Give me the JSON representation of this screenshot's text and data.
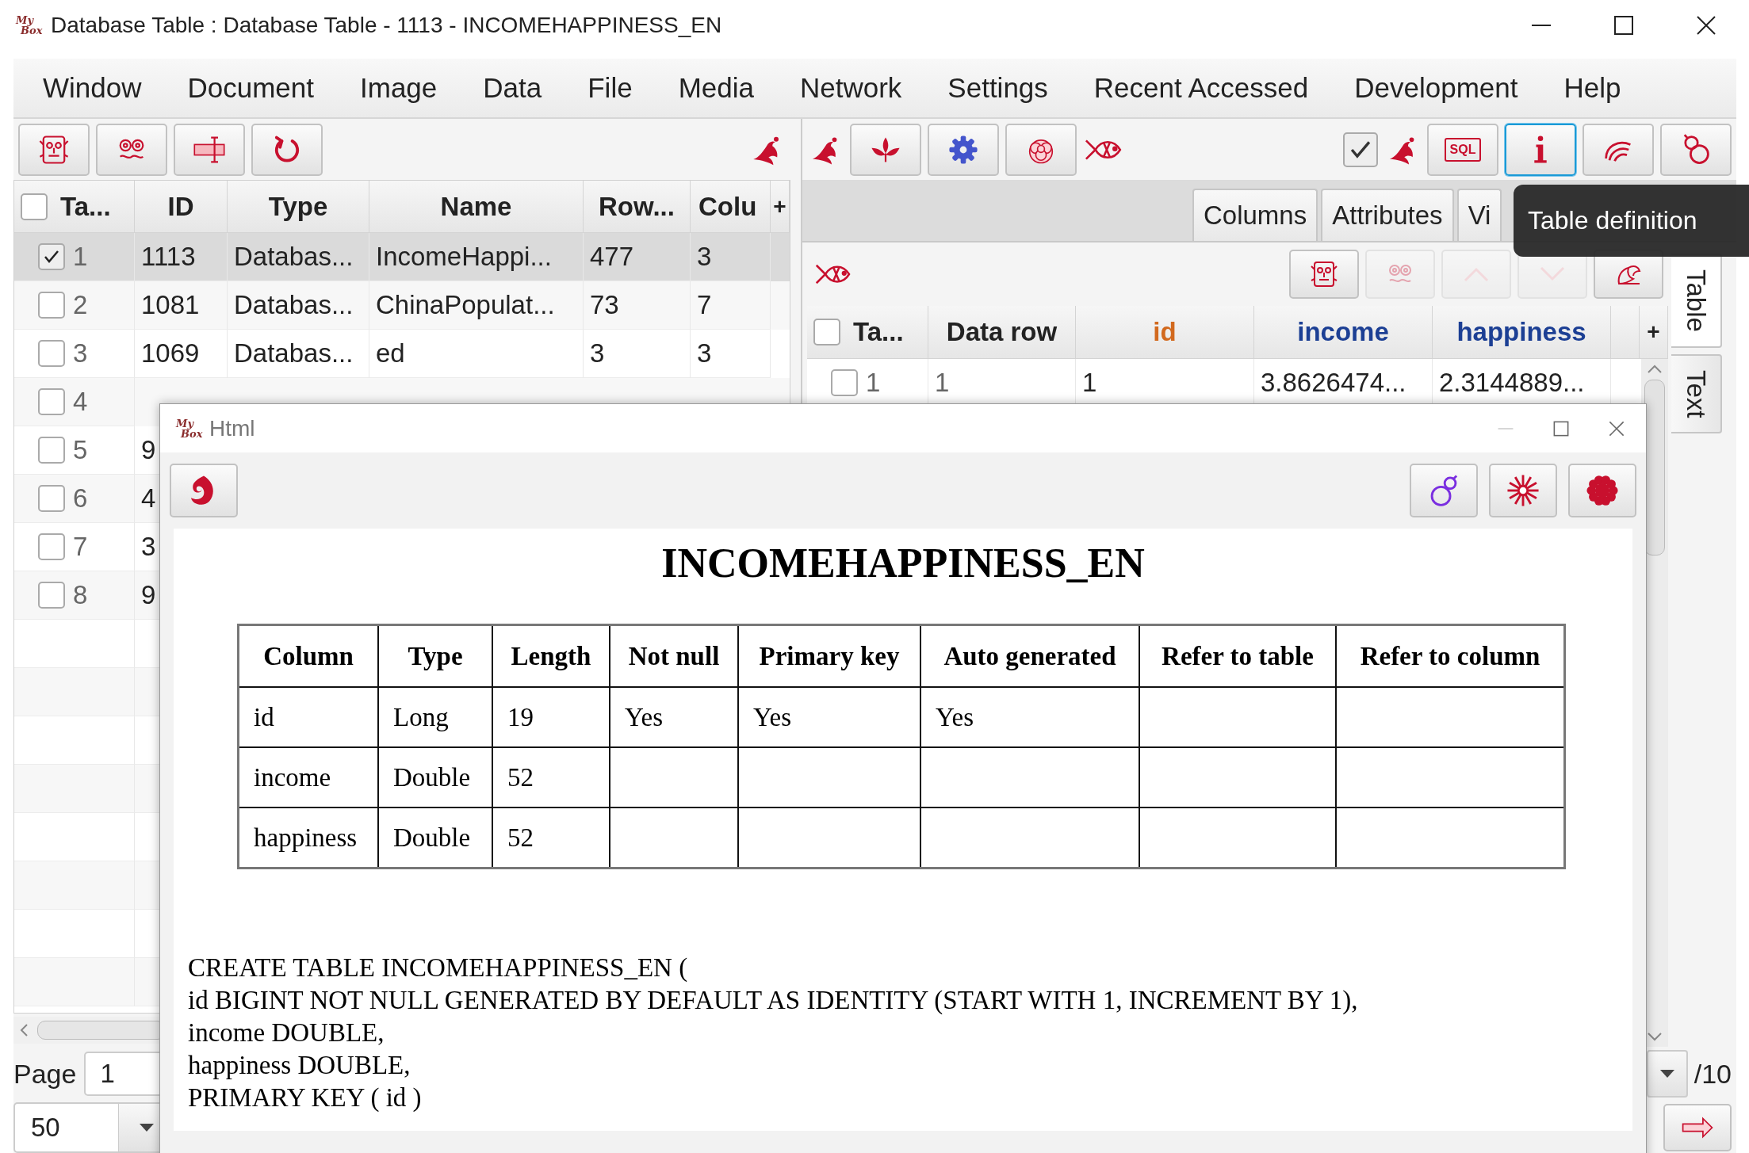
{
  "window": {
    "logo": [
      "My",
      "Box"
    ],
    "title": "Database Table : Database Table - 1113 - INCOMEHAPPINESS_EN"
  },
  "menu": [
    "Window",
    "Document",
    "Image",
    "Data",
    "File",
    "Media",
    "Network",
    "Settings",
    "Recent Accessed",
    "Development",
    "Help"
  ],
  "left_table": {
    "all_checked": false,
    "columns": [
      "Ta...",
      "ID",
      "Type",
      "Name",
      "Row...",
      "Colu"
    ],
    "add_column": "+",
    "rows": [
      {
        "checked": true,
        "selected": true,
        "cells": [
          "1",
          "1113",
          "Databas...",
          "IncomeHappi...",
          "477",
          "3"
        ]
      },
      {
        "checked": false,
        "selected": false,
        "cells": [
          "2",
          "1081",
          "Databas...",
          "ChinaPopulat...",
          "73",
          "7"
        ]
      },
      {
        "checked": false,
        "selected": false,
        "cells": [
          "3",
          "1069",
          "Databas...",
          "ed",
          "3",
          "3"
        ]
      },
      {
        "checked": false,
        "selected": false,
        "cells": [
          "4"
        ]
      },
      {
        "checked": false,
        "selected": false,
        "cells": [
          "5",
          "9"
        ]
      },
      {
        "checked": false,
        "selected": false,
        "cells": [
          "6",
          "4"
        ]
      },
      {
        "checked": false,
        "selected": false,
        "cells": [
          "7",
          "3"
        ]
      },
      {
        "checked": false,
        "selected": false,
        "cells": [
          "8",
          "9"
        ]
      }
    ]
  },
  "pager": {
    "label": "Page",
    "page": "1",
    "page_size": "50",
    "page_total": "/10"
  },
  "right_toolbar": {
    "checkbox": {
      "checked": true
    },
    "sql_label": "SQL",
    "info_focused": true
  },
  "tabs": [
    {
      "label": "Columns",
      "selected": false
    },
    {
      "label": "Attributes",
      "selected": false
    },
    {
      "label": "Vi",
      "selected": false
    }
  ],
  "subtoolbar": [
    {
      "disabled": false
    },
    {
      "disabled": true
    },
    {
      "disabled": true
    },
    {
      "disabled": true
    },
    {
      "disabled": false
    }
  ],
  "data_table": {
    "all_checked": false,
    "columns": [
      {
        "label": "Ta...",
        "kind": "meta"
      },
      {
        "label": "Data row",
        "kind": "meta"
      },
      {
        "label": "id",
        "kind": "key"
      },
      {
        "label": "income",
        "kind": "field"
      },
      {
        "label": "happiness",
        "kind": "field"
      }
    ],
    "add_column": "+",
    "rows": [
      {
        "checked": false,
        "cells": [
          "1",
          "1",
          "1",
          "3.8626474...",
          "2.3144889..."
        ]
      }
    ]
  },
  "side_tabs": [
    {
      "label": "Table",
      "selected": true
    },
    {
      "label": "Text",
      "selected": false
    }
  ],
  "tooltip": "Table definition",
  "html_window": {
    "logo": [
      "My",
      "Box"
    ],
    "title": "Html",
    "heading": "INCOMEHAPPINESS_EN",
    "table": {
      "columns": [
        "Column",
        "Type",
        "Length",
        "Not null",
        "Primary key",
        "Auto generated",
        "Refer to table",
        "Refer to column"
      ],
      "rows": [
        [
          "id",
          "Long",
          "19",
          "Yes",
          "Yes",
          "Yes"
        ],
        [
          "income",
          "Double",
          "52"
        ],
        [
          "happiness",
          "Double",
          "52"
        ]
      ]
    },
    "sql": [
      "CREATE TABLE INCOMEHAPPINESS_EN (",
      "id BIGINT NOT NULL GENERATED BY DEFAULT AS IDENTITY (START WITH 1, INCREMENT BY 1),",
      "income DOUBLE,",
      "happiness DOUBLE,",
      "PRIMARY KEY ( id )"
    ]
  }
}
